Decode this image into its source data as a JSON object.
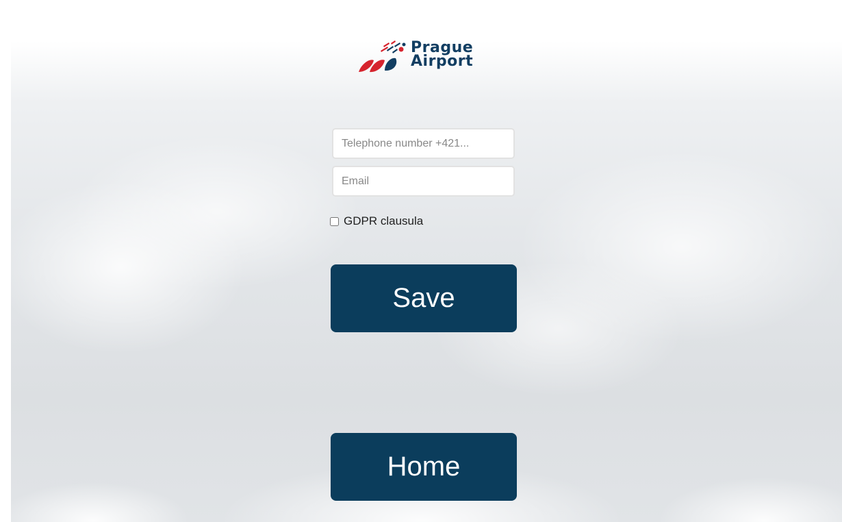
{
  "brand": {
    "line1": "Prague",
    "line2": "Airport",
    "text_color": "#123e62",
    "accent_red": "#d6242e",
    "accent_blue": "#123e62"
  },
  "form": {
    "phone": {
      "placeholder": "Telephone number +421...",
      "value": ""
    },
    "email": {
      "placeholder": "Email",
      "value": ""
    },
    "gdpr": {
      "label": "GDPR clausula",
      "checked": false
    }
  },
  "buttons": {
    "save_label": "Save",
    "home_label": "Home",
    "color": "#0b3d5c"
  },
  "icons": {
    "logo": "prague-airport-logo-icon"
  }
}
